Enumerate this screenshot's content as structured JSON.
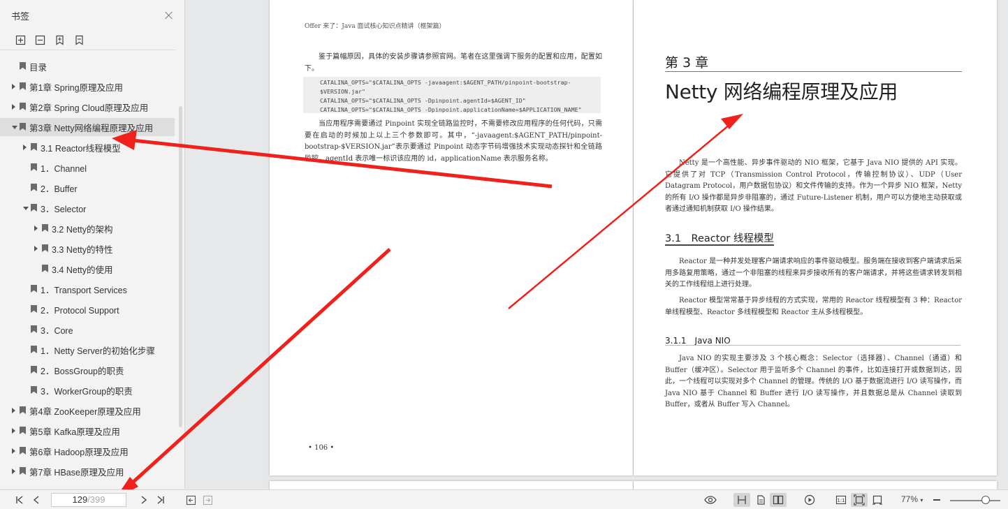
{
  "sidebar": {
    "title": "书签",
    "tree": [
      {
        "label": "目录",
        "expander": "none",
        "x": 27
      },
      {
        "label": "第1章 Spring原理及应用",
        "expander": "right",
        "x": 27
      },
      {
        "label": "第2章 Spring Cloud原理及应用",
        "expander": "right",
        "x": 27
      },
      {
        "label": "第3章 Netty网络编程原理及应用",
        "expander": "down",
        "x": 27,
        "selected": true
      },
      {
        "label": "3.1 Reactor线程模型",
        "expander": "right",
        "x": 43
      },
      {
        "label": "1．Channel",
        "expander": "none",
        "x": 43
      },
      {
        "label": "2．Buffer",
        "expander": "none",
        "x": 43
      },
      {
        "label": "3．Selector",
        "expander": "down",
        "x": 43
      },
      {
        "label": "3.2 Netty的架构",
        "expander": "right",
        "x": 59
      },
      {
        "label": "3.3 Netty的特性",
        "expander": "right",
        "x": 59
      },
      {
        "label": "3.4 Netty的使用",
        "expander": "none",
        "x": 59
      },
      {
        "label": "1．Transport Services",
        "expander": "none",
        "x": 43
      },
      {
        "label": "2．Protocol Support",
        "expander": "none",
        "x": 43
      },
      {
        "label": "3．Core",
        "expander": "none",
        "x": 43
      },
      {
        "label": "1．Netty Server的初始化步骤",
        "expander": "none",
        "x": 43
      },
      {
        "label": "2．BossGroup的职责",
        "expander": "none",
        "x": 43
      },
      {
        "label": "3．WorkerGroup的职责",
        "expander": "none",
        "x": 43
      },
      {
        "label": "第4章 ZooKeeper原理及应用",
        "expander": "right",
        "x": 27
      },
      {
        "label": "第5章 Kafka原理及应用",
        "expander": "right",
        "x": 27
      },
      {
        "label": "第6章 Hadoop原理及应用",
        "expander": "right",
        "x": 27
      },
      {
        "label": "第7章 HBase原理及应用",
        "expander": "right",
        "x": 27
      }
    ]
  },
  "left_page": {
    "running_head": "Offer 来了：Java 面试核心知识点精讲（框架篇）",
    "para1": "鉴于篇幅原因，具体的安装步骤请参照官网。笔者在这里强调下服务的配置和应用，配置如下。",
    "code_lines": [
      "CATALINA_OPTS=\"$CATALINA_OPTS -javaagent:$AGENT_PATH/pinpoint-bootstrap-",
      "$VERSION.jar\"",
      "CATALINA_OPTS=\"$CATALINA_OPTS -Dpinpoint.agentId=$AGENT_ID\"",
      "CATALINA_OPTS=\"$CATALINA_OPTS -Dpinpoint.applicationName=$APPLICATION_NAME\""
    ],
    "para2": "当应用程序需要通过 Pinpoint 实现全链路监控时，不需要修改应用程序的任何代码，只需要在启动的时候加上以上三个参数即可。其中，“-javaagent:$AGENT_PATH/pinpoint-bootstrap-$VERSION.jar”表示要通过 Pinpoint 动态字节码增强技术实现动态探针和全链路监控，agentId 表示唯一标识该应用的 id，applicationName 表示服务名称。",
    "page_number": "• 106 •"
  },
  "right_page": {
    "chapter_label": "第 3 章",
    "chapter_title": "Netty 网络编程原理及应用",
    "intro": "Netty 是一个高性能、异步事件驱动的 NIO 框架，它基于 Java NIO 提供的 API 实现。它提供了对 TCP（Transmission Control Protocol，传输控制协议）、UDP（User Datagram Protocol，用户数据包协议）和文件传输的支持。作为一个异步 NIO 框架，Netty 的所有 I/O 操作都是异步非阻塞的，通过 Future-Listener 机制，用户可以方便地主动获取或者通过通知机制获取 I/O 操作结果。",
    "section_title": "3.1　Reactor 线程模型",
    "sec_para1": "Reactor 是一种并发处理客户端请求响应的事件驱动模型。服务端在接收到客户端请求后采用多路复用策略，通过一个非阻塞的线程来异步接收所有的客户端请求，并将这些请求转发到相关的工作线程组上进行处理。",
    "sec_para2": "Reactor 模型常常基于异步线程的方式实现，常用的 Reactor 线程模型有 3 种：Reactor 单线程模型、Reactor 多线程模型和 Reactor 主从多线程模型。",
    "subsection_title": "3.1.1　Java NIO",
    "sub_para": "Java NIO 的实现主要涉及 3 个核心概念：Selector（选择器）、Channel（通道）和 Buffer（缓冲区）。Selector 用于监听多个 Channel 的事件，比如连接打开或数据到达，因此，一个线程可以实现对多个 Channel 的管理。传统的 I/O 基于数据流进行 I/O 读写操作，而 Java NIO 基于 Channel 和 Buffer 进行 I/O 读写操作，并且数据总是从 Channel 读取到 Buffer，或者从 Buffer 写入 Channel。"
  },
  "bottom_bar": {
    "current_page": "129",
    "total_pages": "/399",
    "zoom": "77%"
  },
  "colors": {
    "arrow": "#f0201a",
    "sidebar_bg": "#f3f3f3",
    "selected_row": "#dedede"
  }
}
